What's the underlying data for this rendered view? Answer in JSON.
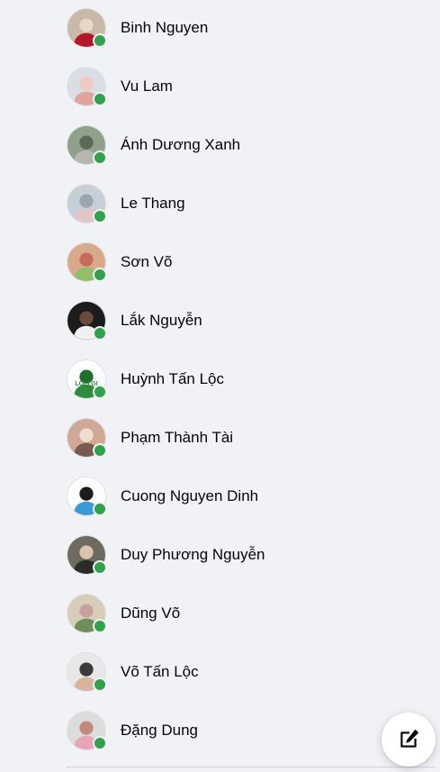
{
  "contacts": [
    {
      "name": "Binh Nguyen",
      "online": true,
      "avatar_colors": [
        "#c9b9a8",
        "#b5172a",
        "#e8d7c8"
      ]
    },
    {
      "name": "Vu Lam",
      "online": true,
      "avatar_colors": [
        "#d9dde4",
        "#e0a49a",
        "#f2c9c0"
      ]
    },
    {
      "name": "Ánh Dương Xanh",
      "online": true,
      "avatar_colors": [
        "#8fa18a",
        "#b6b6b0",
        "#5c6a58"
      ]
    },
    {
      "name": "Le Thang",
      "online": true,
      "avatar_colors": [
        "#c7ced8",
        "#e2c7c6",
        "#9aa5b1"
      ]
    },
    {
      "name": "Sơn Võ",
      "online": true,
      "avatar_colors": [
        "#d8a98a",
        "#8fbf6b",
        "#c46b5a"
      ]
    },
    {
      "name": "Lắk Nguyễn",
      "online": true,
      "avatar_colors": [
        "#1c1c1c",
        "#f1f1f1",
        "#6a4a3a"
      ]
    },
    {
      "name": "Huỳnh Tấn Lộc",
      "online": true,
      "avatar_colors": [
        "#ffffff",
        "#2e8b3d",
        "#1f6e2c"
      ],
      "avatar_text": "LOLI GI"
    },
    {
      "name": "Phạm Thành Tài",
      "online": true,
      "avatar_colors": [
        "#cfa896",
        "#7a5a4e",
        "#f0ddd2"
      ]
    },
    {
      "name": "Cuong Nguyen Dinh",
      "online": true,
      "avatar_colors": [
        "#ffffff",
        "#3a9ad9",
        "#1b1b1b"
      ]
    },
    {
      "name": "Duy Phương Nguyễn",
      "online": true,
      "avatar_colors": [
        "#6d6a5f",
        "#2b2b2b",
        "#d9c4b0"
      ]
    },
    {
      "name": "Dũng Võ",
      "online": true,
      "avatar_colors": [
        "#d8cdb8",
        "#6f8f5a",
        "#c9a0a0"
      ]
    },
    {
      "name": "Võ Tấn Lộc",
      "online": true,
      "avatar_colors": [
        "#e7e7e7",
        "#d9b39d",
        "#3a3a3a"
      ]
    },
    {
      "name": "Đặng Dung",
      "online": true,
      "avatar_colors": [
        "#dcdcdc",
        "#e8a5b8",
        "#c38a7c"
      ]
    }
  ],
  "colors": {
    "background": "#f0f2f5",
    "online": "#31a24c",
    "text": "#050505",
    "divider": "#ced0d4"
  },
  "compose_button": {
    "icon": "compose-icon"
  }
}
